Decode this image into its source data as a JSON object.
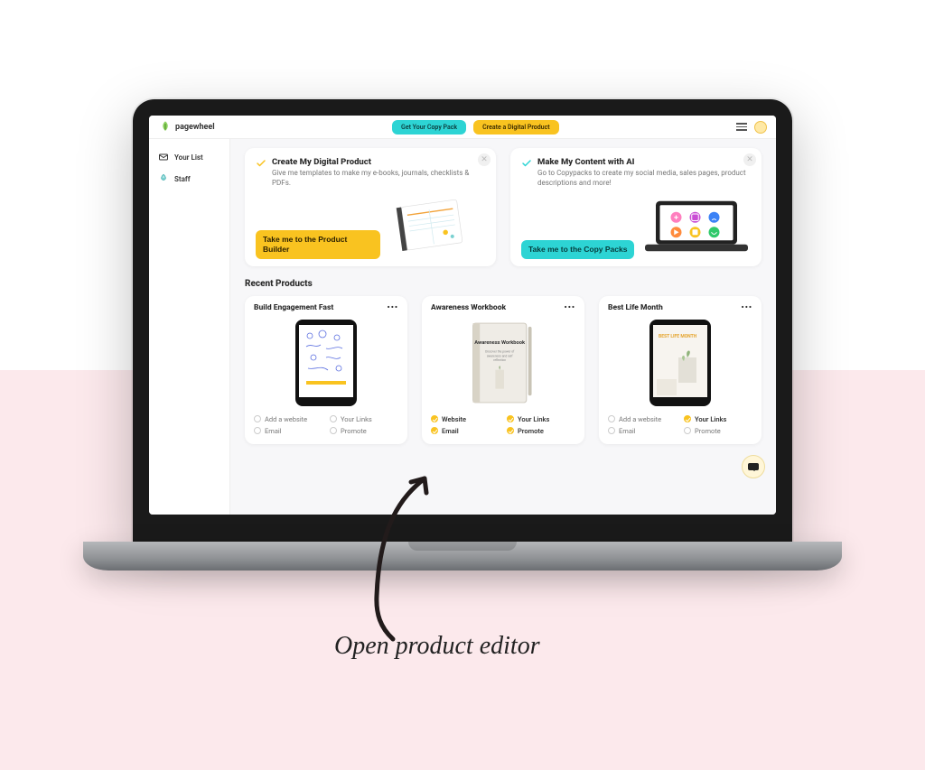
{
  "logo_text": "pagewheel",
  "topbar": {
    "pill_left": "Get Your Copy Pack",
    "pill_right": "Create a Digital Product"
  },
  "sidebar": {
    "items": [
      {
        "icon": "mail-icon",
        "label": "Your List"
      },
      {
        "icon": "rocket-icon",
        "label": "Staff"
      }
    ]
  },
  "cards": [
    {
      "check_color": "#f9c320",
      "title": "Create My Digital Product",
      "desc": "Give me templates to make my e-books, journals, checklists & PDFs.",
      "btn_label": "Take me to the Product Builder"
    },
    {
      "check_color": "#2dd4d4",
      "title": "Make My Content with AI",
      "desc": "Go to Copypacks to create my social media, sales pages, product descriptions and more!",
      "btn_label": "Take me to the Copy Packs"
    }
  ],
  "recent_title": "Recent Products",
  "products": [
    {
      "title": "Build Engagement Fast",
      "cover_label": "",
      "links": [
        {
          "label": "Add a website",
          "on": false
        },
        {
          "label": "Your Links",
          "on": false
        },
        {
          "label": "Email",
          "on": false
        },
        {
          "label": "Promote",
          "on": false
        }
      ]
    },
    {
      "title": "Awareness Workbook",
      "cover_label": "Awareness Workbook",
      "links": [
        {
          "label": "Website",
          "on": true
        },
        {
          "label": "Your Links",
          "on": true
        },
        {
          "label": "Email",
          "on": true
        },
        {
          "label": "Promote",
          "on": true
        }
      ]
    },
    {
      "title": "Best Life Month",
      "cover_label": "BEST LIFE MONTH",
      "links": [
        {
          "label": "Add a website",
          "on": false
        },
        {
          "label": "Your Links",
          "on": true
        },
        {
          "label": "Email",
          "on": false
        },
        {
          "label": "Promote",
          "on": false
        }
      ]
    }
  ],
  "caption": "Open product editor"
}
